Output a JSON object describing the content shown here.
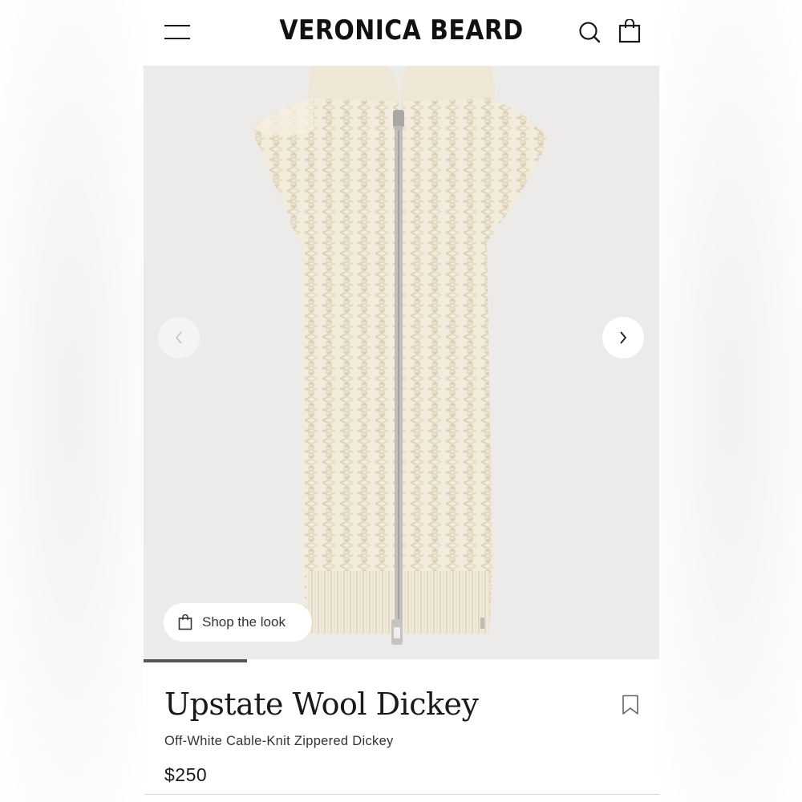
{
  "header": {
    "brand": "VERONICA BEARD",
    "menu_icon": "hamburger-menu-icon",
    "search_icon": "search-icon",
    "bag_icon": "shopping-bag-icon"
  },
  "gallery": {
    "image_description": "product-image",
    "prev_icon": "chevron-left-icon",
    "next_icon": "chevron-right-icon",
    "shop_the_look_label": "Shop the look",
    "progress_fraction": 0.2
  },
  "product": {
    "title": "Upstate Wool Dickey",
    "subtitle": "Off-White Cable-Knit Zippered Dickey",
    "price": "$250",
    "bookmark_icon": "bookmark-icon"
  },
  "colors": {
    "background": "#ffffff",
    "gallery_bg": "#ecebe9",
    "knit": "#f3ecdc",
    "zipper": "#b8b8b8",
    "text": "#1a1a1a"
  }
}
